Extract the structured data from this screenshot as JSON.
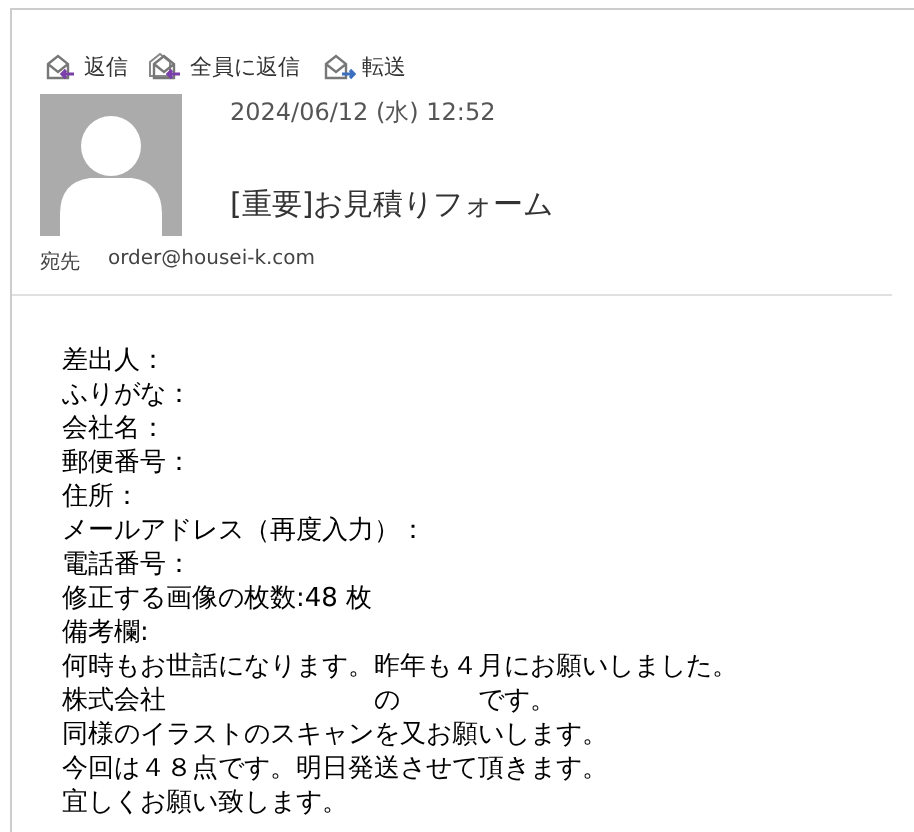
{
  "toolbar": [
    {
      "kind": "reply",
      "label": "返信"
    },
    {
      "kind": "reply_all",
      "label": "全員に返信"
    },
    {
      "kind": "forward",
      "label": "転送"
    }
  ],
  "header": {
    "date": "2024/06/12 (水) 12:52",
    "subject": "[重要]お見積りフォーム",
    "to_label": "宛先",
    "to": "order@housei-k.com"
  },
  "body_lines": [
    "差出人：",
    "ふりがな：",
    "会社名：",
    "郵便番号：",
    "住所：",
    "メールアドレス（再度入力）：",
    "電話番号：",
    "修正する画像の枚数:48 枚",
    "備考欄:",
    "何時もお世話になります。昨年も４月にお願いしました。",
    "株式会社　　　　　　　　の　　　です。",
    "同様のイラストのスキャンを又お願いします。",
    "今回は４８点です。明日発送させて頂きます。",
    "宜しくお願い致します。"
  ]
}
